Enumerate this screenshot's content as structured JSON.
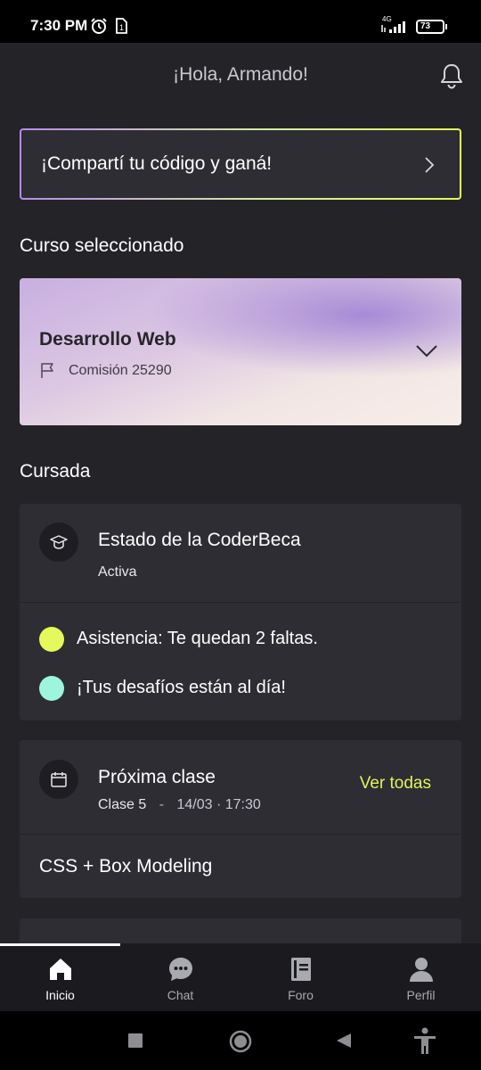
{
  "status_bar": {
    "time": "7:30 PM",
    "network": "4G",
    "battery": "73",
    "icons": [
      "alarm-icon",
      "sim-icon",
      "signal-icon",
      "battery-icon"
    ]
  },
  "header": {
    "greeting": "¡Hola, Armando!",
    "icon": "bell-icon"
  },
  "share_banner": {
    "text": "¡Compartí tu código y ganá!",
    "icon": "chevron-right-icon"
  },
  "selected_course": {
    "section_title": "Curso seleccionado",
    "name": "Desarrollo Web",
    "commission": "Comisión 25290",
    "icons": [
      "flag-icon",
      "chevron-down-icon"
    ]
  },
  "cursada": {
    "section_title": "Cursada",
    "beca": {
      "title": "Estado de la CoderBeca",
      "status": "Activa",
      "icon": "graduation-cap-icon"
    },
    "status_items": [
      {
        "text": "Asistencia: Te quedan 2 faltas.",
        "color": "#e6f95c"
      },
      {
        "text": "¡Tus desafíos están al día!",
        "color": "#9cf5dc"
      }
    ]
  },
  "next_class": {
    "title": "Próxima clase",
    "class_number": "Clase 5",
    "separator": "-",
    "datetime": "14/03 · 17:30",
    "link": "Ver todas",
    "topic": "CSS + Box Modeling",
    "icon": "calendar-icon"
  },
  "bottom_nav": {
    "items": [
      {
        "label": "Inicio",
        "icon": "home-icon",
        "active": true
      },
      {
        "label": "Chat",
        "icon": "chat-icon",
        "active": false
      },
      {
        "label": "Foro",
        "icon": "forum-icon",
        "active": false
      },
      {
        "label": "Perfil",
        "icon": "profile-icon",
        "active": false
      }
    ]
  },
  "system_nav": {
    "icons": [
      "recents-icon",
      "home-button-icon",
      "back-icon",
      "accessibility-icon"
    ]
  },
  "colors": {
    "background": "#242428",
    "card": "#2d2d33",
    "accent_yellow": "#e6f95c",
    "accent_mint": "#9cf5dc",
    "accent_purple": "#b989ee"
  }
}
